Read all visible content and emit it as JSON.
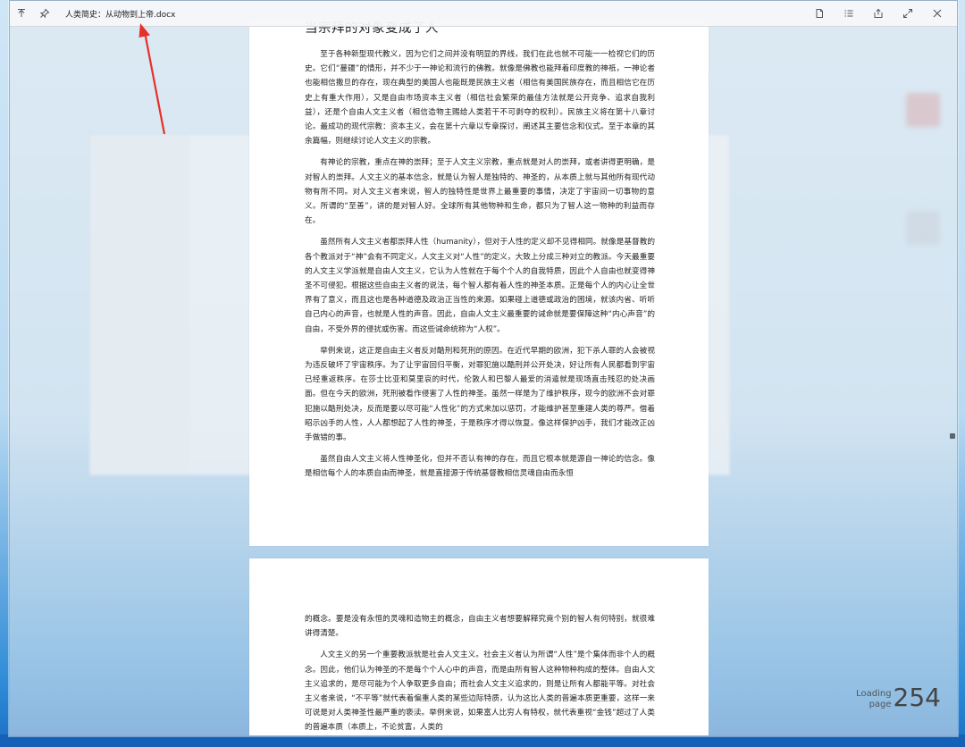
{
  "window": {
    "title": "人类简史：从动物到上帝.docx",
    "icons": [
      "pin-top-icon",
      "pin-icon"
    ],
    "right_icons": [
      "document-icon",
      "list-icon",
      "share-icon",
      "expand-icon",
      "close-icon"
    ]
  },
  "page1": {
    "heading": "当宗拜的对象变成了人",
    "paragraphs": [
      "至于各种新型现代教义，因为它们之间并没有明显的界线，我们在此也就不可能一一检视它们的历史。它们“蔓疆”的情形，并不少于一神论和流行的佛教。就像是佛教也能拜着印度教的神祇，一神论者也能相信撒旦的存在，现在典型的美国人也能既是民族主义者（相信有美国民族存在，而且相信它在历史上有重大作用），又是自由市场资本主义者（相信社会繁荣的最佳方法就是公开竞争、追求自我利益），还是个自由人文主义者（相信造物主赐给人类若干不可剥夺的权利）。民族主义将在第十八章讨论。最成功的现代宗教：资本主义，会在第十六章以专章探讨，阐述其主要信念和仪式。至于本章的其余篇幅，则继续讨论人文主义的宗教。",
      "有神论的宗教，重点在神的崇拜；至于人文主义宗教，重点就是对人的崇拜，或者讲得更明确，是对智人的崇拜。人文主义的基本信念，就是认为智人是独特的、神圣的，从本质上就与其他所有现代动物有所不同。对人文主义者来说，智人的独特性是世界上最重要的事情，决定了宇宙间一切事物的意义。所谓的“至善”，讲的是对智人好。全球所有其他物种和生命，都只为了智人这一物种的利益而存在。",
      "虽然所有人文主义者都崇拜人性（humanity），但对于人性的定义却不见得相同。就像是基督教的各个教派对于“神”会有不同定义，人文主义对“人性”的定义，大致上分成三种对立的教派。今天最重要的人文主义学派就是自由人文主义，它认为人性就在于每个个人的自我特质，因此个人自由也就变得神圣不可侵犯。根据这些自由主义者的说法，每个智人都有着人性的神圣本质。正是每个人的内心让全世界有了意义，而且这也是各种道德及政治正当性的来源。如果碰上道德或政治的困境，就该内省、听听自己内心的声音，也就是人性的声音。因此，自由人文主义最重要的诫命就是要保障这种“内心声音”的自由，不受外界的侵扰或伤害。而这些诫命统称为“人权”。",
      "举例来说，这正是自由主义者反对酷刑和死刑的原因。在近代早期的欧洲，犯下杀人罪的人会被视为违反破坏了宇宙秩序。为了让宇宙回归平衡，对罪犯施以酷刑并公开处决，好让所有人民都看到宇宙已经重返秩序。在莎士比亚和莫里哀的时代，伦敦人和巴黎人最爱的消遣就是现场直击残忍的处决画面。但在今天的欧洲，死刑被看作侵害了人性的神圣。虽然一样是为了维护秩序，现今的欧洲不会对罪犯施以酷刑处决，反而是要以尽可能“人性化”的方式来加以惩罚，才能维护甚至重建人类的尊严。借着昭示凶手的人性，人人都想起了人性的神圣，于是秩序才得以恢复。像这样保护凶手，我们才能改正凶手做错的事。",
      "虽然自由人文主义将人性神圣化，但并不否认有神的存在，而且它根本就是源自一神论的信念。像是相信每个人的本质自由而神圣，就是直接源于传统基督教相信灵魂自由而永恒"
    ]
  },
  "page2": {
    "paragraphs": [
      "的概念。要是没有永恒的灵魂和造物主的概念，自由主义者想要解释究竟个别的智人有何特别，就很难讲得清楚。",
      "人文主义的另一个重要教派就是社会人文主义。社会主义者认为所谓“人性”是个集体而非个人的概念。因此，他们认为神圣的不是每个个人心中的声音，而是由所有智人这种物种构成的整体。自由人文主义追求的，是尽可能为个人争取更多自由；而社会人文主义追求的，则是让所有人都能平等。对社会主义者来说，“不平等”就代表着偏重人类的某些边际特质，认为这比人类的普遍本质更重要，这样一来可说是对人类神圣性最严重的亵渎。举例来说，如果富人比穷人有特权，就代表重视“金钱”超过了人类的普遍本质（本质上，不论贫富，人类的"
    ]
  },
  "loading": {
    "label_line1": "Loading",
    "label_line2": "page",
    "number": "254"
  },
  "colors": {
    "arrow": "#e8302a",
    "desktop_blue": "#1b6fc4"
  }
}
